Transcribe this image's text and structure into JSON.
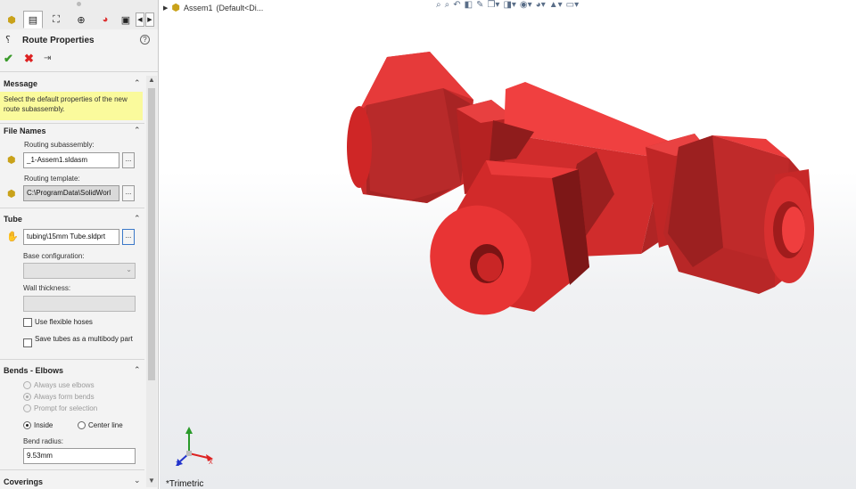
{
  "panel": {
    "tabs": [
      {
        "name": "featuremanager-tab",
        "icon": "assembly-icon",
        "glyph": "⬢"
      },
      {
        "name": "propertymanager-tab",
        "icon": "propertymanager-icon",
        "glyph": "▤"
      },
      {
        "name": "configurationmanager-tab",
        "icon": "configuration-icon",
        "glyph": "⛶"
      },
      {
        "name": "dimxpert-tab",
        "icon": "dimxpert-icon",
        "glyph": "⊕"
      },
      {
        "name": "display-manager-tab",
        "icon": "display-manager-icon",
        "glyph": "◕"
      },
      {
        "name": "routing-tab",
        "icon": "routing-icon",
        "glyph": "▣"
      }
    ],
    "title": "Route Properties",
    "help_symbol": "?",
    "actions": {
      "ok": "✔",
      "cancel": "✖",
      "pin": "⇥"
    },
    "groups": {
      "message": {
        "title": "Message",
        "text": "Select the default properties of the new route subassembly."
      },
      "file_names": {
        "title": "File Names",
        "routing_subassembly_label": "Routing subassembly:",
        "routing_subassembly_value": "_1-Assem1.sldasm",
        "routing_template_label": "Routing template:",
        "routing_template_value": "C:\\ProgramData\\SolidWorl",
        "browse": "..."
      },
      "tube": {
        "title": "Tube",
        "part_value": "tubing\\15mm Tube.sldprt",
        "base_configuration_label": "Base configuration:",
        "base_configuration_value": "",
        "wall_thickness_label": "Wall thickness:",
        "wall_thickness_value": "",
        "use_flexible_hoses": "Use flexible hoses",
        "save_tubes_multibody": "Save tubes as a multibody part"
      },
      "bends": {
        "title": "Bends - Elbows",
        "always_use_elbows": "Always use elbows",
        "always_form_bends": "Always form bends",
        "prompt_for_selection": "Prompt for selection",
        "inside": "Inside",
        "center_line": "Center line",
        "bend_radius_label": "Bend radius:",
        "bend_radius_value": "9.53mm"
      },
      "coverings": {
        "title": "Coverings"
      }
    }
  },
  "viewport": {
    "breadcrumb_assembly": "Assem1",
    "breadcrumb_config": "(Default<Di...",
    "view_name": "*Trimetric",
    "triad": {
      "x": "X",
      "y": "Y",
      "z": "Z"
    },
    "model_color": "#e8262a",
    "heads_up_icons": [
      "zoom-to-fit-icon",
      "zoom-area-icon",
      "previous-view-icon",
      "section-view-icon",
      "dynamic-annotation-icon",
      "view-orientation-icon",
      "display-style-icon",
      "hide-show-icon",
      "edit-appearance-icon",
      "apply-scene-icon",
      "view-settings-icon"
    ]
  }
}
